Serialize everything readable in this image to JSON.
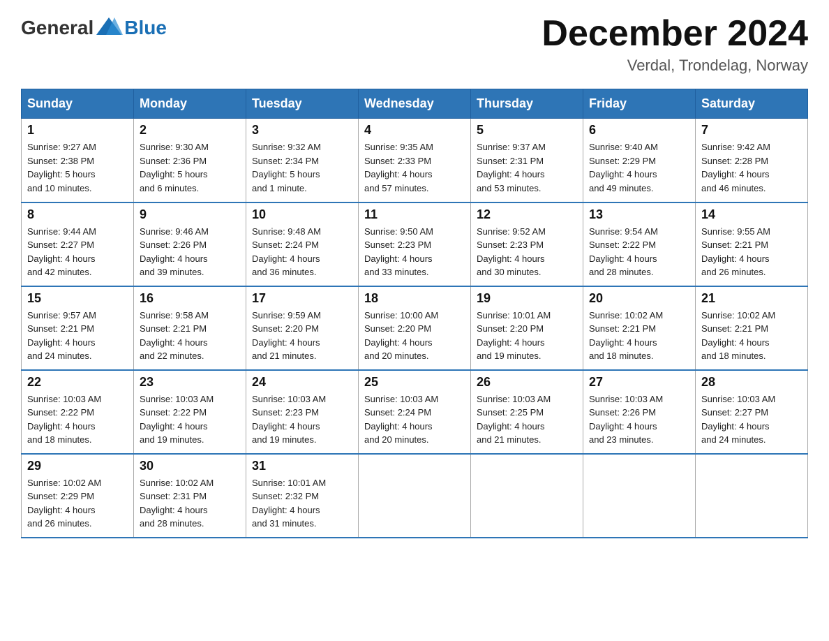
{
  "logo": {
    "text_general": "General",
    "text_blue": "Blue"
  },
  "title": "December 2024",
  "subtitle": "Verdal, Trondelag, Norway",
  "days_of_week": [
    "Sunday",
    "Monday",
    "Tuesday",
    "Wednesday",
    "Thursday",
    "Friday",
    "Saturday"
  ],
  "weeks": [
    [
      {
        "day": "1",
        "sunrise": "9:27 AM",
        "sunset": "2:38 PM",
        "daylight": "5 hours and 10 minutes."
      },
      {
        "day": "2",
        "sunrise": "9:30 AM",
        "sunset": "2:36 PM",
        "daylight": "5 hours and 6 minutes."
      },
      {
        "day": "3",
        "sunrise": "9:32 AM",
        "sunset": "2:34 PM",
        "daylight": "5 hours and 1 minute."
      },
      {
        "day": "4",
        "sunrise": "9:35 AM",
        "sunset": "2:33 PM",
        "daylight": "4 hours and 57 minutes."
      },
      {
        "day": "5",
        "sunrise": "9:37 AM",
        "sunset": "2:31 PM",
        "daylight": "4 hours and 53 minutes."
      },
      {
        "day": "6",
        "sunrise": "9:40 AM",
        "sunset": "2:29 PM",
        "daylight": "4 hours and 49 minutes."
      },
      {
        "day": "7",
        "sunrise": "9:42 AM",
        "sunset": "2:28 PM",
        "daylight": "4 hours and 46 minutes."
      }
    ],
    [
      {
        "day": "8",
        "sunrise": "9:44 AM",
        "sunset": "2:27 PM",
        "daylight": "4 hours and 42 minutes."
      },
      {
        "day": "9",
        "sunrise": "9:46 AM",
        "sunset": "2:26 PM",
        "daylight": "4 hours and 39 minutes."
      },
      {
        "day": "10",
        "sunrise": "9:48 AM",
        "sunset": "2:24 PM",
        "daylight": "4 hours and 36 minutes."
      },
      {
        "day": "11",
        "sunrise": "9:50 AM",
        "sunset": "2:23 PM",
        "daylight": "4 hours and 33 minutes."
      },
      {
        "day": "12",
        "sunrise": "9:52 AM",
        "sunset": "2:23 PM",
        "daylight": "4 hours and 30 minutes."
      },
      {
        "day": "13",
        "sunrise": "9:54 AM",
        "sunset": "2:22 PM",
        "daylight": "4 hours and 28 minutes."
      },
      {
        "day": "14",
        "sunrise": "9:55 AM",
        "sunset": "2:21 PM",
        "daylight": "4 hours and 26 minutes."
      }
    ],
    [
      {
        "day": "15",
        "sunrise": "9:57 AM",
        "sunset": "2:21 PM",
        "daylight": "4 hours and 24 minutes."
      },
      {
        "day": "16",
        "sunrise": "9:58 AM",
        "sunset": "2:21 PM",
        "daylight": "4 hours and 22 minutes."
      },
      {
        "day": "17",
        "sunrise": "9:59 AM",
        "sunset": "2:20 PM",
        "daylight": "4 hours and 21 minutes."
      },
      {
        "day": "18",
        "sunrise": "10:00 AM",
        "sunset": "2:20 PM",
        "daylight": "4 hours and 20 minutes."
      },
      {
        "day": "19",
        "sunrise": "10:01 AM",
        "sunset": "2:20 PM",
        "daylight": "4 hours and 19 minutes."
      },
      {
        "day": "20",
        "sunrise": "10:02 AM",
        "sunset": "2:21 PM",
        "daylight": "4 hours and 18 minutes."
      },
      {
        "day": "21",
        "sunrise": "10:02 AM",
        "sunset": "2:21 PM",
        "daylight": "4 hours and 18 minutes."
      }
    ],
    [
      {
        "day": "22",
        "sunrise": "10:03 AM",
        "sunset": "2:22 PM",
        "daylight": "4 hours and 18 minutes."
      },
      {
        "day": "23",
        "sunrise": "10:03 AM",
        "sunset": "2:22 PM",
        "daylight": "4 hours and 19 minutes."
      },
      {
        "day": "24",
        "sunrise": "10:03 AM",
        "sunset": "2:23 PM",
        "daylight": "4 hours and 19 minutes."
      },
      {
        "day": "25",
        "sunrise": "10:03 AM",
        "sunset": "2:24 PM",
        "daylight": "4 hours and 20 minutes."
      },
      {
        "day": "26",
        "sunrise": "10:03 AM",
        "sunset": "2:25 PM",
        "daylight": "4 hours and 21 minutes."
      },
      {
        "day": "27",
        "sunrise": "10:03 AM",
        "sunset": "2:26 PM",
        "daylight": "4 hours and 23 minutes."
      },
      {
        "day": "28",
        "sunrise": "10:03 AM",
        "sunset": "2:27 PM",
        "daylight": "4 hours and 24 minutes."
      }
    ],
    [
      {
        "day": "29",
        "sunrise": "10:02 AM",
        "sunset": "2:29 PM",
        "daylight": "4 hours and 26 minutes."
      },
      {
        "day": "30",
        "sunrise": "10:02 AM",
        "sunset": "2:31 PM",
        "daylight": "4 hours and 28 minutes."
      },
      {
        "day": "31",
        "sunrise": "10:01 AM",
        "sunset": "2:32 PM",
        "daylight": "4 hours and 31 minutes."
      },
      null,
      null,
      null,
      null
    ]
  ],
  "labels": {
    "sunrise": "Sunrise:",
    "sunset": "Sunset:",
    "daylight": "Daylight:"
  }
}
